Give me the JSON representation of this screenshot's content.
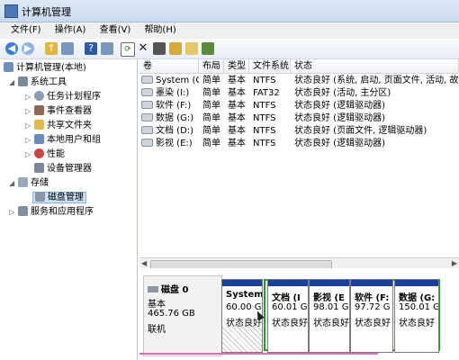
{
  "window": {
    "title": "计算机管理"
  },
  "menu": [
    "文件(F)",
    "操作(A)",
    "查看(V)",
    "帮助(H)"
  ],
  "toolbar_icons": [
    "back-icon",
    "forward-icon",
    "up-icon",
    "show-hide-tree-icon",
    "help-icon",
    "properties-icon",
    "refresh-icon",
    "delete-icon",
    "open-icon",
    "rescan-icon",
    "search-icon",
    "action-icon"
  ],
  "tree": {
    "root": "计算机管理(本地)",
    "system_tools": "系统工具",
    "task_scheduler": "任务计划程序",
    "event_viewer": "事件查看器",
    "shared_folders": "共享文件夹",
    "local_users": "本地用户和组",
    "performance": "性能",
    "device_manager": "设备管理器",
    "storage": "存储",
    "disk_management": "磁盘管理",
    "services": "服务和应用程序"
  },
  "columns": [
    "卷",
    "布局",
    "类型",
    "文件系统",
    "状态"
  ],
  "volumes": [
    {
      "name": "System (C:)",
      "layout": "简单",
      "type": "基本",
      "fs": "NTFS",
      "status": "状态良好 (系统, 启动, 页面文件, 活动, 故障转"
    },
    {
      "name": "墨染 (I:)",
      "layout": "简单",
      "type": "基本",
      "fs": "FAT32",
      "status": "状态良好 (活动, 主分区)"
    },
    {
      "name": "软件 (F:)",
      "layout": "简单",
      "type": "基本",
      "fs": "NTFS",
      "status": "状态良好 (逻辑驱动器)"
    },
    {
      "name": "数据 (G:)",
      "layout": "简单",
      "type": "基本",
      "fs": "NTFS",
      "status": "状态良好 (逻辑驱动器)"
    },
    {
      "name": "文档 (D:)",
      "layout": "简单",
      "type": "基本",
      "fs": "NTFS",
      "status": "状态良好 (页面文件, 逻辑驱动器)"
    },
    {
      "name": "影视 (E:)",
      "layout": "简单",
      "type": "基本",
      "fs": "NTFS",
      "status": "状态良好 (逻辑驱动器)"
    }
  ],
  "disk": {
    "label": "磁盘 0",
    "type": "基本",
    "size": "465.76 GB",
    "state": "联机",
    "partitions": [
      {
        "name": "System",
        "size": "60.00 G",
        "status": "状态良好"
      },
      {
        "name": "文档 (I",
        "size": "60.01 G",
        "status": "状态良好"
      },
      {
        "name": "影视 (E",
        "size": "98.01 G",
        "status": "状态良好"
      },
      {
        "name": "软件 (F:",
        "size": "97.72 G",
        "status": "状态良好"
      },
      {
        "name": "数据 (G:",
        "size": "150.01 G",
        "status": "状态良好"
      }
    ]
  },
  "colors": {
    "primary_band": "#1d3f9c",
    "extended_border": "#22a022",
    "selection": "#cde3f9"
  }
}
